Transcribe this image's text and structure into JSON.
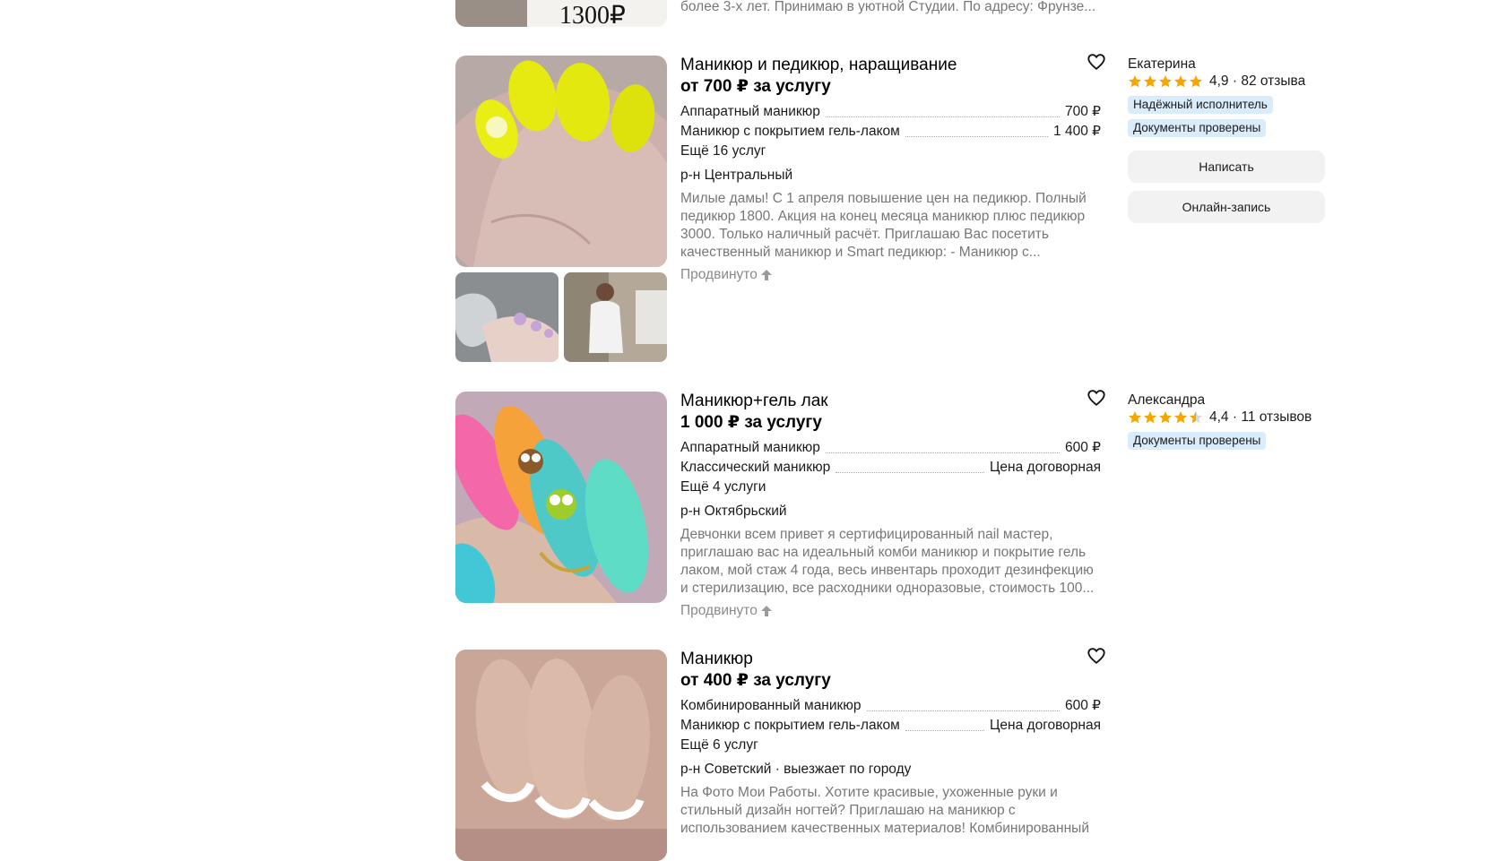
{
  "top_partial": {
    "desc_tail": "более 3-х лет. Принимаю в уютной Студии. По адресу: Фрунзе...",
    "image_price_text": "1300₽"
  },
  "listings": [
    {
      "title": "Маникюр и педикюр, наращивание",
      "price": "от 700 ₽ за услугу",
      "services": [
        {
          "name": "Аппаратный маникюр",
          "price": "700 ₽"
        },
        {
          "name": "Маникюр с покрытием гель-лаком",
          "price": "1 400 ₽"
        }
      ],
      "more": "Ещё 16 услуг",
      "district": "р-н Центральный",
      "description": "Милые дамы! С 1 апреля повышение цен на педикюр. Полный педикюр 1800. Акция на конец месяца маникюр плюс педикюр 3000. Только наличный расчёт. Приглашаю Вас посетить качественный маникюр и Smart педикюр: - Маникюр с...",
      "promoted": "Продвинуто",
      "seller": {
        "name": "Екатерина",
        "rating": "4,9",
        "stars": 5,
        "reviews": "82 отзыва",
        "badges": [
          "Надёжный исполнитель",
          "Документы проверены"
        ],
        "buttons": [
          "Написать",
          "Онлайн-запись"
        ]
      }
    },
    {
      "title": "Маникюр+гель лак",
      "price": "1 000 ₽ за услугу",
      "services": [
        {
          "name": "Аппаратный маникюр",
          "price": "600 ₽"
        },
        {
          "name": "Классический маникюр",
          "price": "Цена договорная"
        }
      ],
      "more": "Ещё 4 услуги",
      "district": "р-н Октябрьский",
      "description": "Девчонки всем привет я сертифицированный nail мастер, приглашаю вас на идеальный комби маникюр и покрытие гель лаком, мой стаж 4 года, весь инвентарь проходит дезинфекцию и стерилизацию, все расходники одноразовые, стоимость 100...",
      "promoted": "Продвинуто",
      "seller": {
        "name": "Александра",
        "rating": "4,4",
        "stars": 4.5,
        "reviews": "11 отзывов",
        "badges": [
          "Документы проверены"
        ]
      }
    },
    {
      "title": "Маникюр",
      "price": "от 400 ₽ за услугу",
      "services": [
        {
          "name": "Комбинированный маникюр",
          "price": "600 ₽"
        },
        {
          "name": "Маникюр с покрытием гель-лаком",
          "price": "Цена договорная"
        }
      ],
      "more": "Ещё 6 услуг",
      "district": "р-н Советский · выезжает по городу",
      "description": "На Фото Мои Работы. Хотите красивые, ухоженные руки и стильный дизайн ногтей? Приглашаю на маникюр с использованием качественных материалов! Комбинированный"
    }
  ],
  "colors": {
    "star": "#f7a600",
    "badge_bg": "#d9ecfb",
    "button_bg": "#f2f2f2",
    "muted_text": "#777777"
  }
}
